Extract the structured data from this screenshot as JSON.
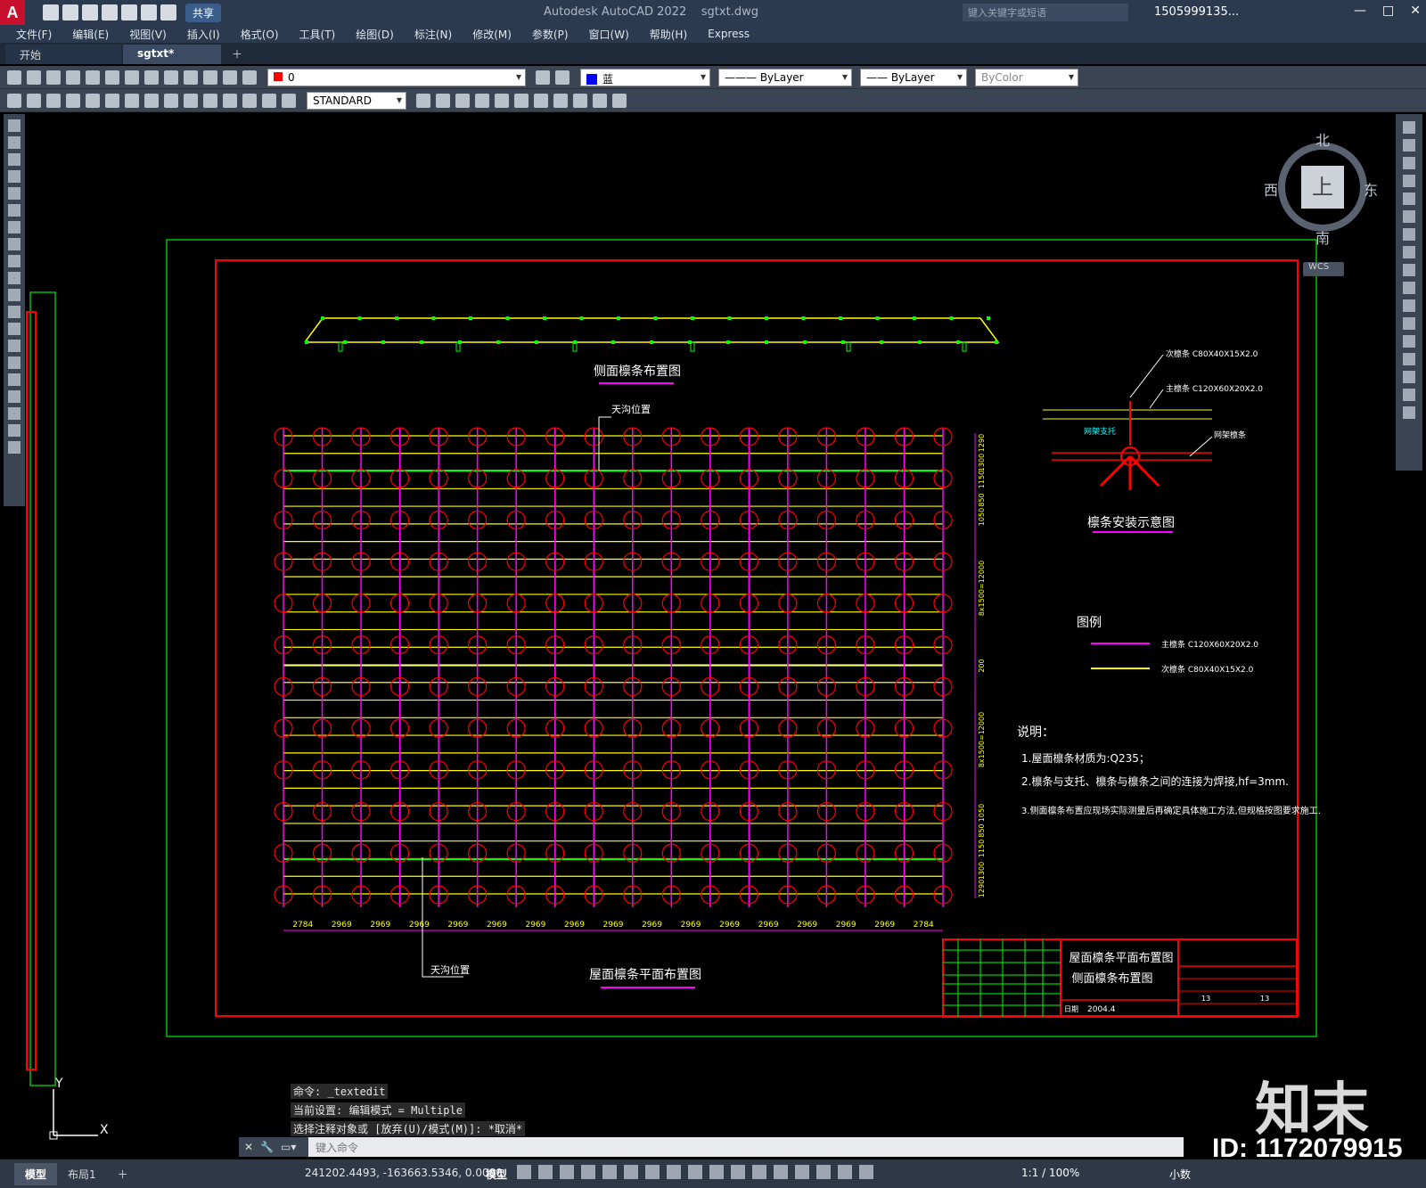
{
  "app": {
    "title": "Autodesk AutoCAD 2022",
    "filename": "sgtxt.dwg",
    "logo": "A",
    "share_label": "共享",
    "search_placeholder": "键入关键字或短语",
    "user": "1505999135...",
    "window_controls": [
      "—",
      "□",
      "✕"
    ]
  },
  "menu": [
    "文件(F)",
    "编辑(E)",
    "视图(V)",
    "插入(I)",
    "格式(O)",
    "工具(T)",
    "绘图(D)",
    "标注(N)",
    "修改(M)",
    "参数(P)",
    "窗口(W)",
    "帮助(H)",
    "Express"
  ],
  "tabs": [
    "开始",
    "sgtxt*"
  ],
  "properties": {
    "layer": "0",
    "color": "蓝",
    "linetype": "ByLayer",
    "lineweight": "ByLayer",
    "plotstyle": "ByColor",
    "textstyle": "STANDARD"
  },
  "viewcube": {
    "north": "北",
    "south": "南",
    "east": "东",
    "west": "西",
    "face": "上",
    "wcs": "WCS"
  },
  "drawing": {
    "side_title": "侧面檩条布置图",
    "plan_title": "屋面檩条平面布置图",
    "skylight_label": "天沟位置",
    "install_title": "檩条安装示意图",
    "install_labels": [
      "次檩条 C80X40X15X2.0",
      "主檩条 C120X60X20X2.0",
      "网架支托",
      "网架檩条"
    ],
    "legend_title": "图例",
    "legend": [
      {
        "label": "主檩条 C120X60X20X2.0",
        "color": "#ff00ff"
      },
      {
        "label": "次檩条 C80X40X15X2.0",
        "color": "#ffff00"
      }
    ],
    "notes_title": "说明：",
    "notes": [
      "1.屋面檩条材质为:Q235；",
      "2.檩条与支托、檩条与檩条之间的连接为焊接,hf=3mm.",
      "3.侧面檩条布置应现场实际测量后再确定具体施工方法,但规格按图要求施工."
    ],
    "bottom_dims": [
      "2784",
      "2969",
      "2969",
      "2969",
      "2969",
      "2969",
      "2969",
      "2969",
      "2969",
      "2969",
      "2969",
      "2969",
      "2969",
      "2969",
      "2969",
      "2969",
      "2784"
    ],
    "right_dims": [
      "1290",
      "1300",
      "1150",
      "850",
      "1050",
      "8x1500=12000",
      "200",
      "8x1500=12000",
      "1050",
      "850",
      "1150",
      "1300",
      "1290"
    ],
    "titleblock": {
      "line1": "屋面檩条平面布置图",
      "line2": "侧面檩条布置图",
      "date_label": "日期",
      "date": "2004.4",
      "sheet": "13",
      "total": "13"
    },
    "colors": {
      "frame_outer": "#00c000",
      "frame_inner": "#ff0000",
      "main_purlin": "#ff00ff",
      "secondary_purlin": "#ffff00",
      "grid_circle": "#ff0000",
      "green_line": "#00ff00"
    }
  },
  "command": {
    "history": [
      "命令: _textedit",
      "当前设置: 编辑模式 = Multiple",
      "选择注释对象或 [放弃(U)/模式(M)]: *取消*"
    ],
    "placeholder": "键入命令"
  },
  "status": {
    "layouts": [
      "模型",
      "布局1"
    ],
    "coords": "241202.4493, -163663.5346, 0.0000",
    "model": "模型",
    "zoom": "1:1 / 100%",
    "units": "小数"
  },
  "watermark": {
    "logo": "知末",
    "id": "ID: 1172079915"
  },
  "ucs": {
    "x": "X",
    "y": "Y"
  }
}
